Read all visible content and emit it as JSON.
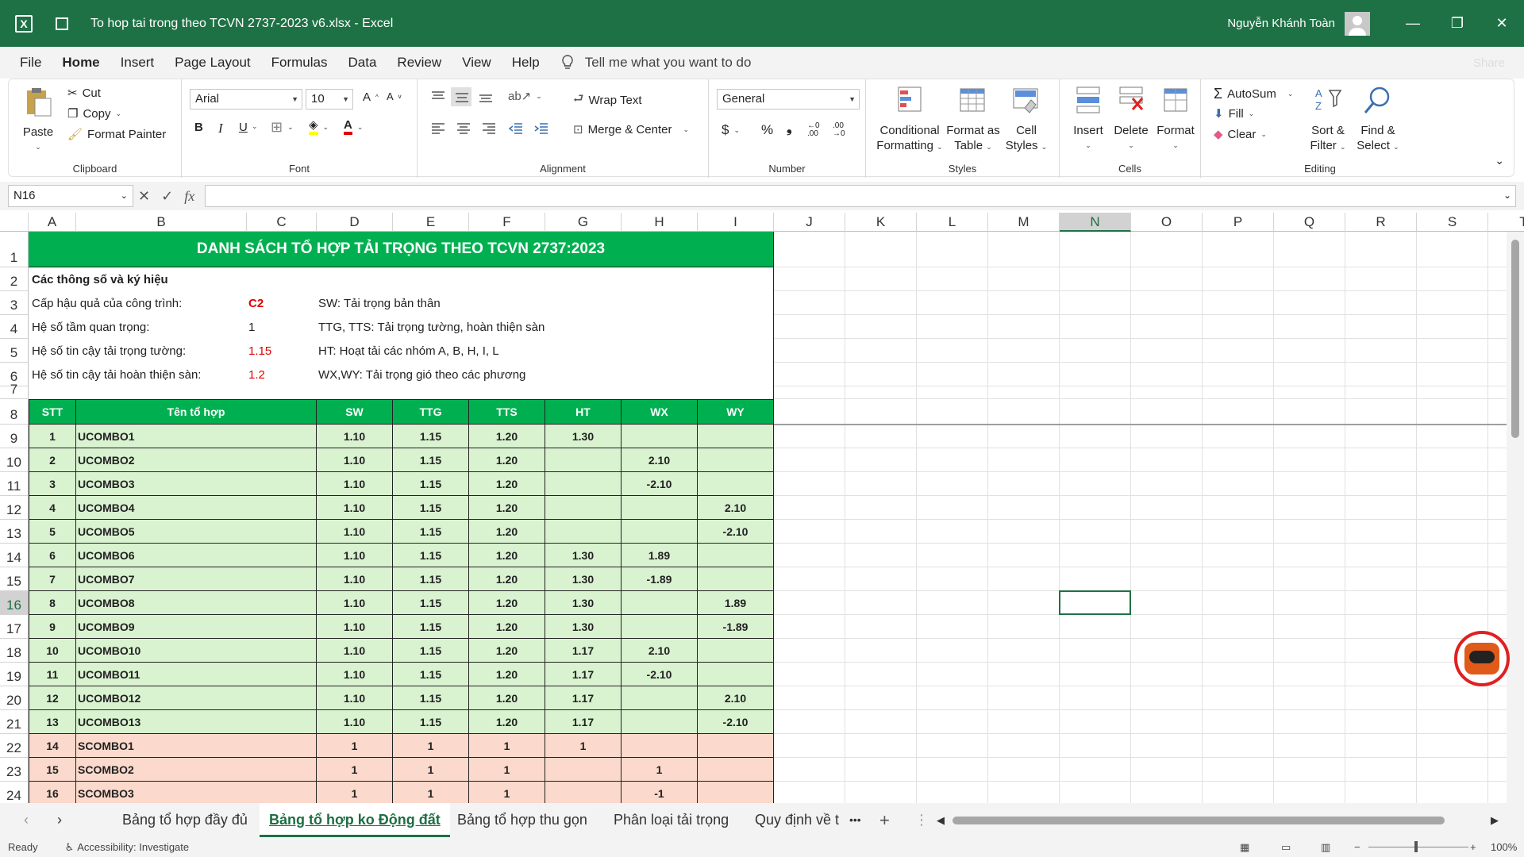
{
  "window": {
    "title": "To hop tai trong theo TCVN 2737-2023 v6.xlsx  -  Excel",
    "user": "Nguyễn Khánh Toàn",
    "minimize_icon": "—",
    "restore_icon": "❐",
    "close_icon": "✕"
  },
  "menu": {
    "tabs": [
      "File",
      "Home",
      "Insert",
      "Page Layout",
      "Formulas",
      "Data",
      "Review",
      "View",
      "Help"
    ],
    "active": "Home",
    "tell_me": "Tell me what you want to do",
    "share": "Share"
  },
  "ribbon": {
    "clipboard": {
      "paste": "Paste",
      "cut": "Cut",
      "copy": "Copy",
      "format_painter": "Format Painter",
      "label": "Clipboard"
    },
    "font": {
      "name": "Arial",
      "size": "10",
      "bold": "B",
      "italic": "I",
      "underline": "U",
      "label": "Font"
    },
    "alignment": {
      "wrap_text": "Wrap Text",
      "merge_center": "Merge & Center",
      "label": "Alignment"
    },
    "number": {
      "format": "General",
      "currency": "$",
      "percent": "%",
      "comma": "❟",
      "label": "Number"
    },
    "styles": {
      "conditional": "Conditional",
      "conditional2": "Formatting",
      "format_table": "Format as",
      "format_table2": "Table",
      "cell_styles": "Cell",
      "cell_styles2": "Styles",
      "label": "Styles"
    },
    "cells": {
      "insert": "Insert",
      "delete": "Delete",
      "format": "Format",
      "label": "Cells"
    },
    "editing": {
      "autosum": "AutoSum",
      "fill": "Fill",
      "clear": "Clear",
      "sort": "Sort &",
      "sort2": "Filter",
      "find": "Find &",
      "find2": "Select",
      "label": "Editing"
    }
  },
  "formula_bar": {
    "name_box": "N16",
    "fx": "fx",
    "formula": ""
  },
  "columns": [
    "A",
    "B",
    "C",
    "D",
    "E",
    "F",
    "G",
    "H",
    "I",
    "J",
    "K",
    "L",
    "M",
    "N",
    "O",
    "P",
    "Q",
    "R",
    "S",
    "T"
  ],
  "rows": [
    "1",
    "2",
    "3",
    "4",
    "5",
    "6",
    "7",
    "8",
    "9",
    "10",
    "11",
    "12",
    "13",
    "14",
    "15",
    "16",
    "17",
    "18",
    "19",
    "20",
    "21",
    "22",
    "23",
    "24"
  ],
  "sheet": {
    "title": "DANH SÁCH TỔ HỢP TẢI TRỌNG THEO TCVN 2737:2023",
    "params_heading": "Các thông số và ký hiệu",
    "params": [
      {
        "label": "Cấp hậu quả của công trình:",
        "value": "C2",
        "note": "SW: Tải trọng bản thân"
      },
      {
        "label": "Hệ số tầm quan trọng:",
        "value": "1",
        "note": "TTG, TTS: Tải trọng tường, hoàn thiện sàn"
      },
      {
        "label": "Hệ số tin cậy tải trọng tường:",
        "value": "1.15",
        "note": "HT: Hoạt tải các nhóm A, B, H, I, L"
      },
      {
        "label": "Hệ số tin cậy tải hoàn thiện sàn:",
        "value": "1.2",
        "note": "WX,WY: Tải trọng gió theo các phương"
      }
    ],
    "table_headers": [
      "STT",
      "Tên tổ hợp",
      "SW",
      "TTG",
      "TTS",
      "HT",
      "WX",
      "WY"
    ],
    "table_rows": [
      [
        "1",
        "UCOMBO1",
        "1.10",
        "1.15",
        "1.20",
        "1.30",
        "",
        ""
      ],
      [
        "2",
        "UCOMBO2",
        "1.10",
        "1.15",
        "1.20",
        "",
        "2.10",
        ""
      ],
      [
        "3",
        "UCOMBO3",
        "1.10",
        "1.15",
        "1.20",
        "",
        "-2.10",
        ""
      ],
      [
        "4",
        "UCOMBO4",
        "1.10",
        "1.15",
        "1.20",
        "",
        "",
        "2.10"
      ],
      [
        "5",
        "UCOMBO5",
        "1.10",
        "1.15",
        "1.20",
        "",
        "",
        "-2.10"
      ],
      [
        "6",
        "UCOMBO6",
        "1.10",
        "1.15",
        "1.20",
        "1.30",
        "1.89",
        ""
      ],
      [
        "7",
        "UCOMBO7",
        "1.10",
        "1.15",
        "1.20",
        "1.30",
        "-1.89",
        ""
      ],
      [
        "8",
        "UCOMBO8",
        "1.10",
        "1.15",
        "1.20",
        "1.30",
        "",
        "1.89"
      ],
      [
        "9",
        "UCOMBO9",
        "1.10",
        "1.15",
        "1.20",
        "1.30",
        "",
        "-1.89"
      ],
      [
        "10",
        "UCOMBO10",
        "1.10",
        "1.15",
        "1.20",
        "1.17",
        "2.10",
        ""
      ],
      [
        "11",
        "UCOMBO11",
        "1.10",
        "1.15",
        "1.20",
        "1.17",
        "-2.10",
        ""
      ],
      [
        "12",
        "UCOMBO12",
        "1.10",
        "1.15",
        "1.20",
        "1.17",
        "",
        "2.10"
      ],
      [
        "13",
        "UCOMBO13",
        "1.10",
        "1.15",
        "1.20",
        "1.17",
        "",
        "-2.10"
      ],
      [
        "14",
        "SCOMBO1",
        "1",
        "1",
        "1",
        "1",
        "",
        ""
      ],
      [
        "15",
        "SCOMBO2",
        "1",
        "1",
        "1",
        "",
        "1",
        ""
      ],
      [
        "16",
        "SCOMBO3",
        "1",
        "1",
        "1",
        "",
        "-1",
        ""
      ]
    ]
  },
  "sheet_tabs": [
    "Bảng tổ hợp đầy đủ",
    "Bảng tổ hợp ko Động đất",
    "Bảng tổ hợp thu gọn",
    "Phân loại tải trọng",
    "Quy định về t"
  ],
  "active_sheet_tab": 1,
  "status": {
    "ready": "Ready",
    "accessibility": "Accessibility: Investigate",
    "zoom": "100%"
  },
  "colors": {
    "excel_green": "#1e7145",
    "title_green": "#00b050",
    "ucombo_fill": "#d9f2d0",
    "scombo_fill": "#fbd9cc",
    "param_red": "#e00000"
  }
}
